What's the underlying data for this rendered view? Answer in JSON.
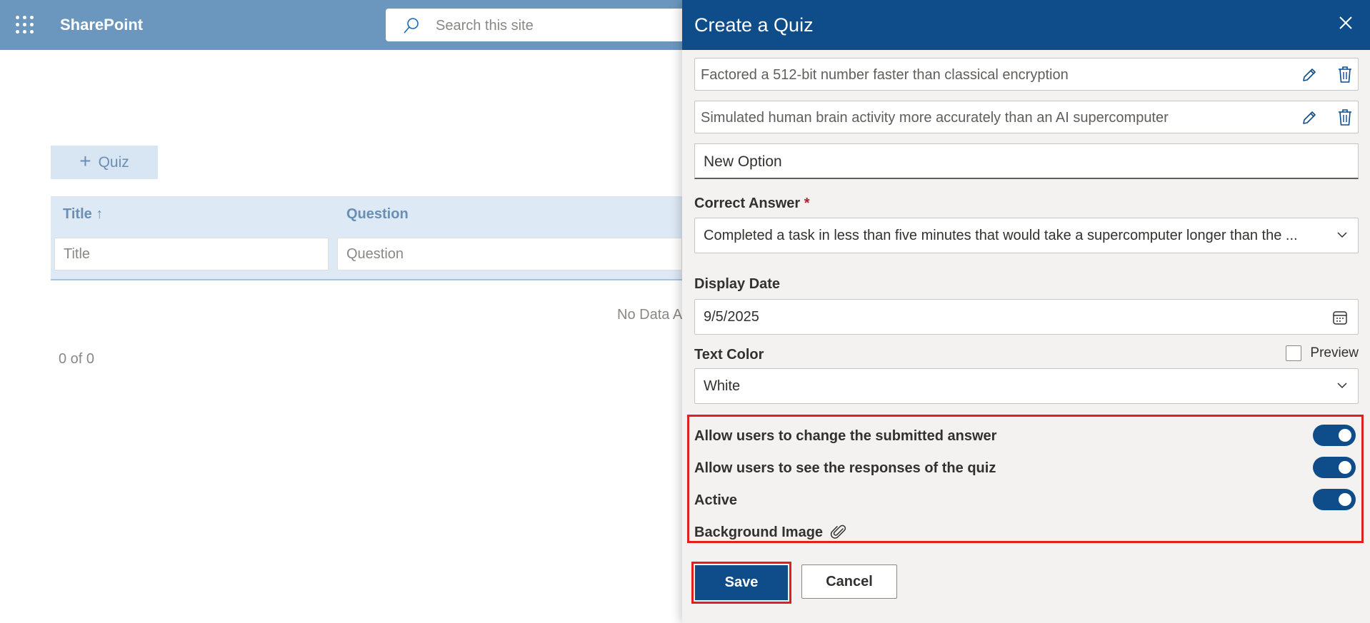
{
  "app": {
    "brand": "SharePoint"
  },
  "search": {
    "placeholder": "Search this site"
  },
  "list": {
    "add_button_label": "Quiz",
    "columns": [
      "Title ↑",
      "Question"
    ],
    "filter_placeholders": [
      "Title",
      "Question"
    ],
    "empty_message": "No Data A",
    "pager": "0 of 0"
  },
  "panel": {
    "title": "Create a Quiz",
    "options": [
      "Factored a 512-bit number faster than classical encryption",
      "Simulated human brain activity more accurately than an AI supercomputer"
    ],
    "new_option_placeholder": "New Option",
    "correct_answer": {
      "label": "Correct Answer",
      "required_mark": "*",
      "value": "Completed a task in less than five minutes that would take a supercomputer longer than the ..."
    },
    "display_date": {
      "label": "Display Date",
      "value": "9/5/2025"
    },
    "text_color": {
      "label": "Text Color",
      "value": "White",
      "preview_label": "Preview",
      "preview_checked": false
    },
    "toggles": [
      {
        "label": "Allow users to change the submitted answer",
        "on": true
      },
      {
        "label": "Allow users to see the responses of the quiz",
        "on": true
      },
      {
        "label": "Active",
        "on": true
      }
    ],
    "background_image_label": "Background Image",
    "save_label": "Save",
    "cancel_label": "Cancel"
  },
  "colors": {
    "topbar": "#6b97bf",
    "panel_header": "#0f4c8a",
    "accent": "#0f4c8a",
    "highlight": "#e0201d"
  }
}
